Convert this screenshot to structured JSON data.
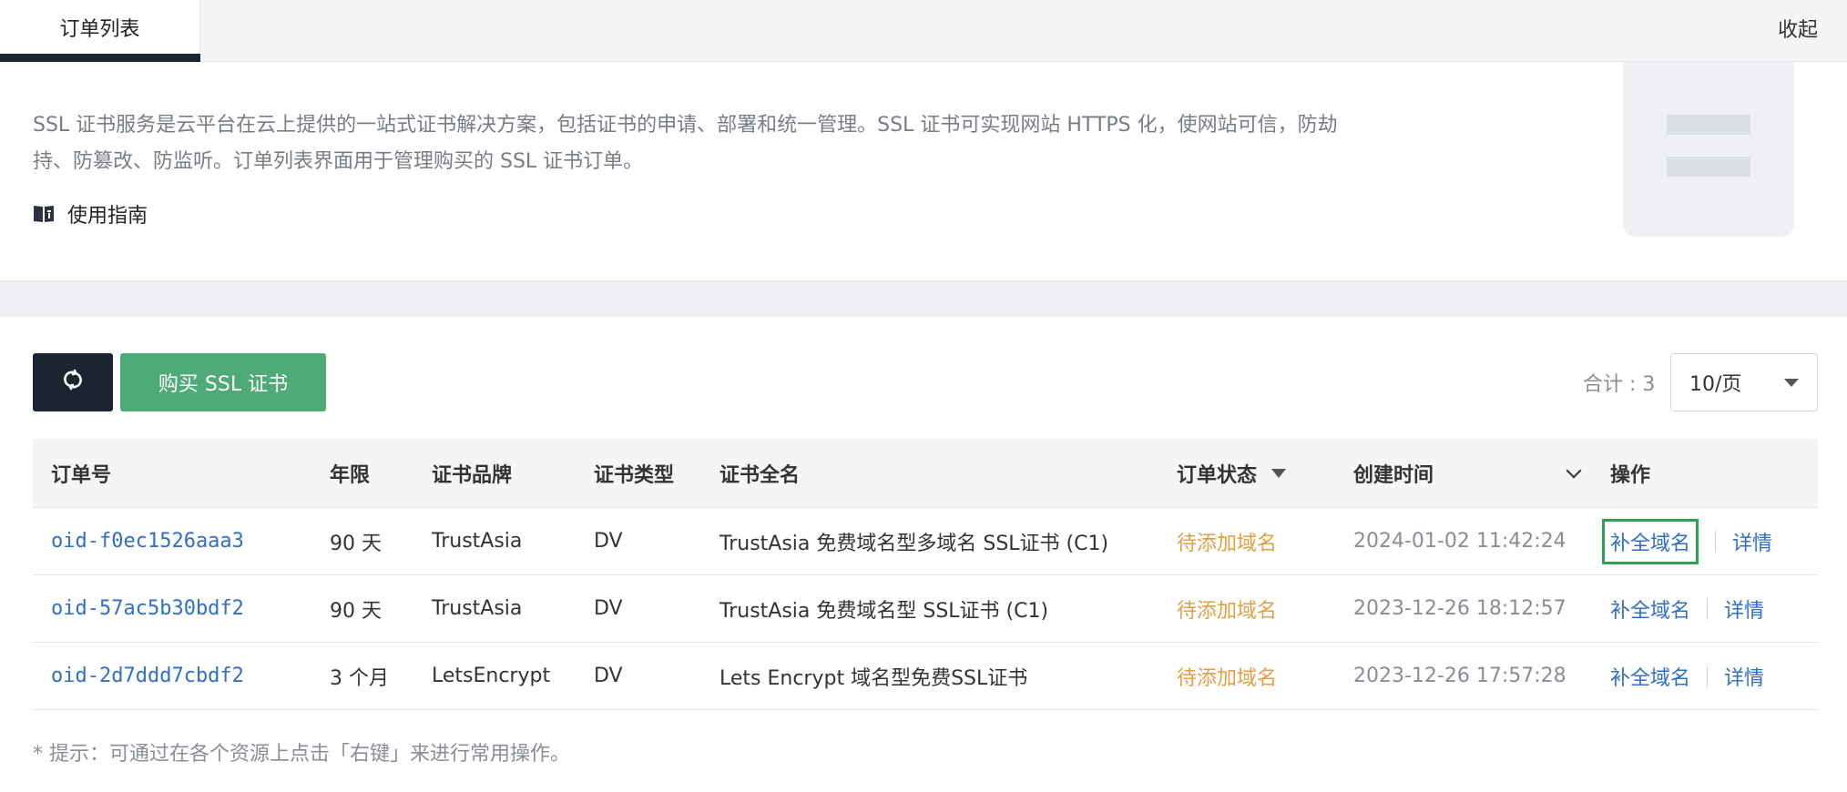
{
  "tabs": {
    "active_label": "订单列表",
    "collapse_label": "收起"
  },
  "intro": {
    "description_line1": "SSL 证书服务是云平台在云上提供的一站式证书解决方案，包括证书的申请、部署和统一管理。SSL 证书可实现网站 HTTPS 化，使网站可信，防劫",
    "description_line2": "持、防篡改、防监听。订单列表界面用于管理购买的 SSL 证书订单。",
    "guide_label": "使用指南",
    "guide_icon": "book-icon"
  },
  "toolbar": {
    "refresh_icon": "refresh-icon",
    "buy_label": "购买 SSL 证书",
    "total_label": "合计 : 3",
    "page_size": "10/页"
  },
  "table": {
    "columns": [
      "订单号",
      "年限",
      "证书品牌",
      "证书类型",
      "证书全名",
      "订单状态",
      "创建时间",
      "操作"
    ],
    "rows": [
      {
        "order_id": "oid-f0ec1526aaa3",
        "period": "90 天",
        "brand": "TrustAsia",
        "type": "DV",
        "full_name": "TrustAsia 免费域名型多域名 SSL证书 (C1)",
        "status": "待添加域名",
        "created": "2024-01-02 11:42:24",
        "action_complete": "补全域名",
        "action_detail": "详情"
      },
      {
        "order_id": "oid-57ac5b30bdf2",
        "period": "90 天",
        "brand": "TrustAsia",
        "type": "DV",
        "full_name": "TrustAsia 免费域名型 SSL证书 (C1)",
        "status": "待添加域名",
        "created": "2023-12-26 18:12:57",
        "action_complete": "补全域名",
        "action_detail": "详情"
      },
      {
        "order_id": "oid-2d7ddd7cbdf2",
        "period": "3 个月",
        "brand": "LetsEncrypt",
        "type": "DV",
        "full_name": "Lets Encrypt 域名型免费SSL证书",
        "status": "待添加域名",
        "created": "2023-12-26 17:57:28",
        "action_complete": "补全域名",
        "action_detail": "详情"
      }
    ]
  },
  "hint": "* 提示：可通过在各个资源上点击「右键」来进行常用操作。",
  "colors": {
    "dark": "#1b2431",
    "green": "#4eaa76",
    "link": "#2f6ec9",
    "status": "#e0a046",
    "highlight": "#2ea24e"
  }
}
